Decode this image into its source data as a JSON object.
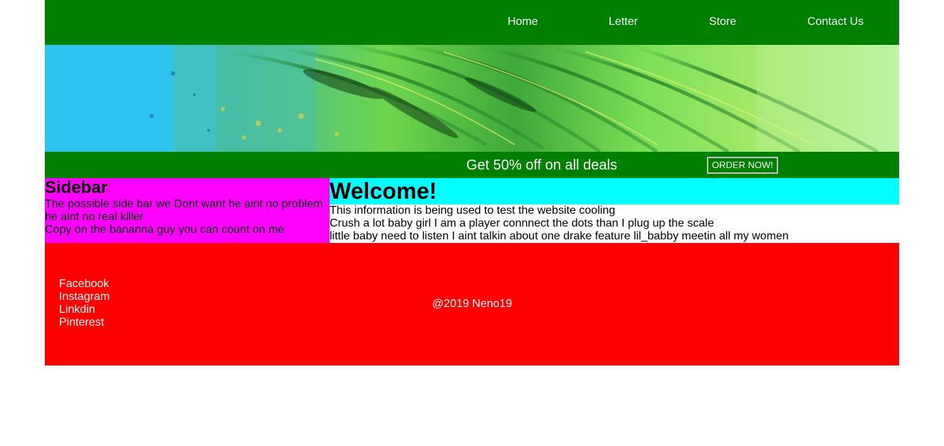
{
  "nav": {
    "items": [
      {
        "label": "Home"
      },
      {
        "label": "Letter"
      },
      {
        "label": "Store"
      },
      {
        "label": "Contact Us"
      }
    ]
  },
  "promo": {
    "text": "Get 50% off on all deals",
    "button_label": "ORDER NOW!"
  },
  "sidebar": {
    "title": "Sidebar",
    "lines": [
      "The possible side bar we Dont want he aint no problem he aint no real killer",
      "Copy on the bananna guy you can count on me"
    ]
  },
  "main": {
    "title": "Welcome!",
    "lines": [
      "This information is being used to test the website cooling",
      "Crush a lot baby girl I am a player connnect the dots than I plug up the scale",
      "little baby need to listen I aint talkin about one drake feature lil_babby meetin all my women"
    ]
  },
  "footer": {
    "social": [
      {
        "label": "Facebook"
      },
      {
        "label": "Instagram"
      },
      {
        "label": "Linkdin"
      },
      {
        "label": "Pinterest"
      }
    ],
    "copyright": "@2019 Neno19"
  },
  "colors": {
    "nav_bg": "#008000",
    "promo_bg": "#008000",
    "sidebar_bg": "#ff00ff",
    "heading_bg": "#00ffff",
    "footer_bg": "#ff0000"
  }
}
